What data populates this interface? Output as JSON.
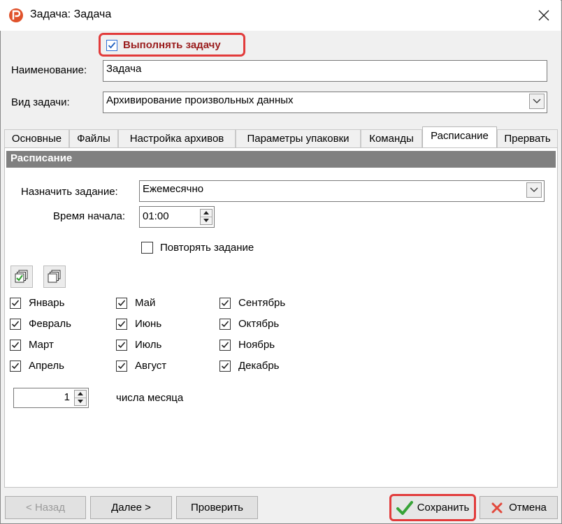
{
  "window": {
    "title": "Задача: Задача"
  },
  "task": {
    "execute_label": "Выполнять задачу",
    "execute_checked": true,
    "name_label": "Наименование:",
    "name_value": "Задача",
    "type_label": "Вид задачи:",
    "type_value": "Архивирование произвольных данных"
  },
  "tabs": [
    {
      "label": "Основные"
    },
    {
      "label": "Файлы"
    },
    {
      "label": "Настройка архивов"
    },
    {
      "label": "Параметры упаковки"
    },
    {
      "label": "Команды"
    },
    {
      "label": "Расписание",
      "active": true
    },
    {
      "label": "Прервать"
    }
  ],
  "schedule": {
    "header": "Расписание",
    "assign_label": "Назначить задание:",
    "assign_value": "Ежемесячно",
    "start_time_label": "Время начала:",
    "start_time_value": "01:00",
    "repeat_label": "Повторять задание",
    "repeat_checked": false,
    "months": [
      [
        "Январь",
        "Май",
        "Сентябрь"
      ],
      [
        "Февраль",
        "Июнь",
        "Октябрь"
      ],
      [
        "Март",
        "Июль",
        "Ноябрь"
      ],
      [
        "Апрель",
        "Август",
        "Декабрь"
      ]
    ],
    "months_checked": true,
    "day_value": "1",
    "day_label": "числа месяца"
  },
  "buttons": {
    "back": "< Назад",
    "next": "Далее >",
    "check": "Проверить",
    "save": "Сохранить",
    "cancel": "Отмена"
  },
  "colors": {
    "highlight": "#e23b3b",
    "section_header": "#808080",
    "exec_label": "#9a1d1d",
    "logo": "#e0522b"
  }
}
